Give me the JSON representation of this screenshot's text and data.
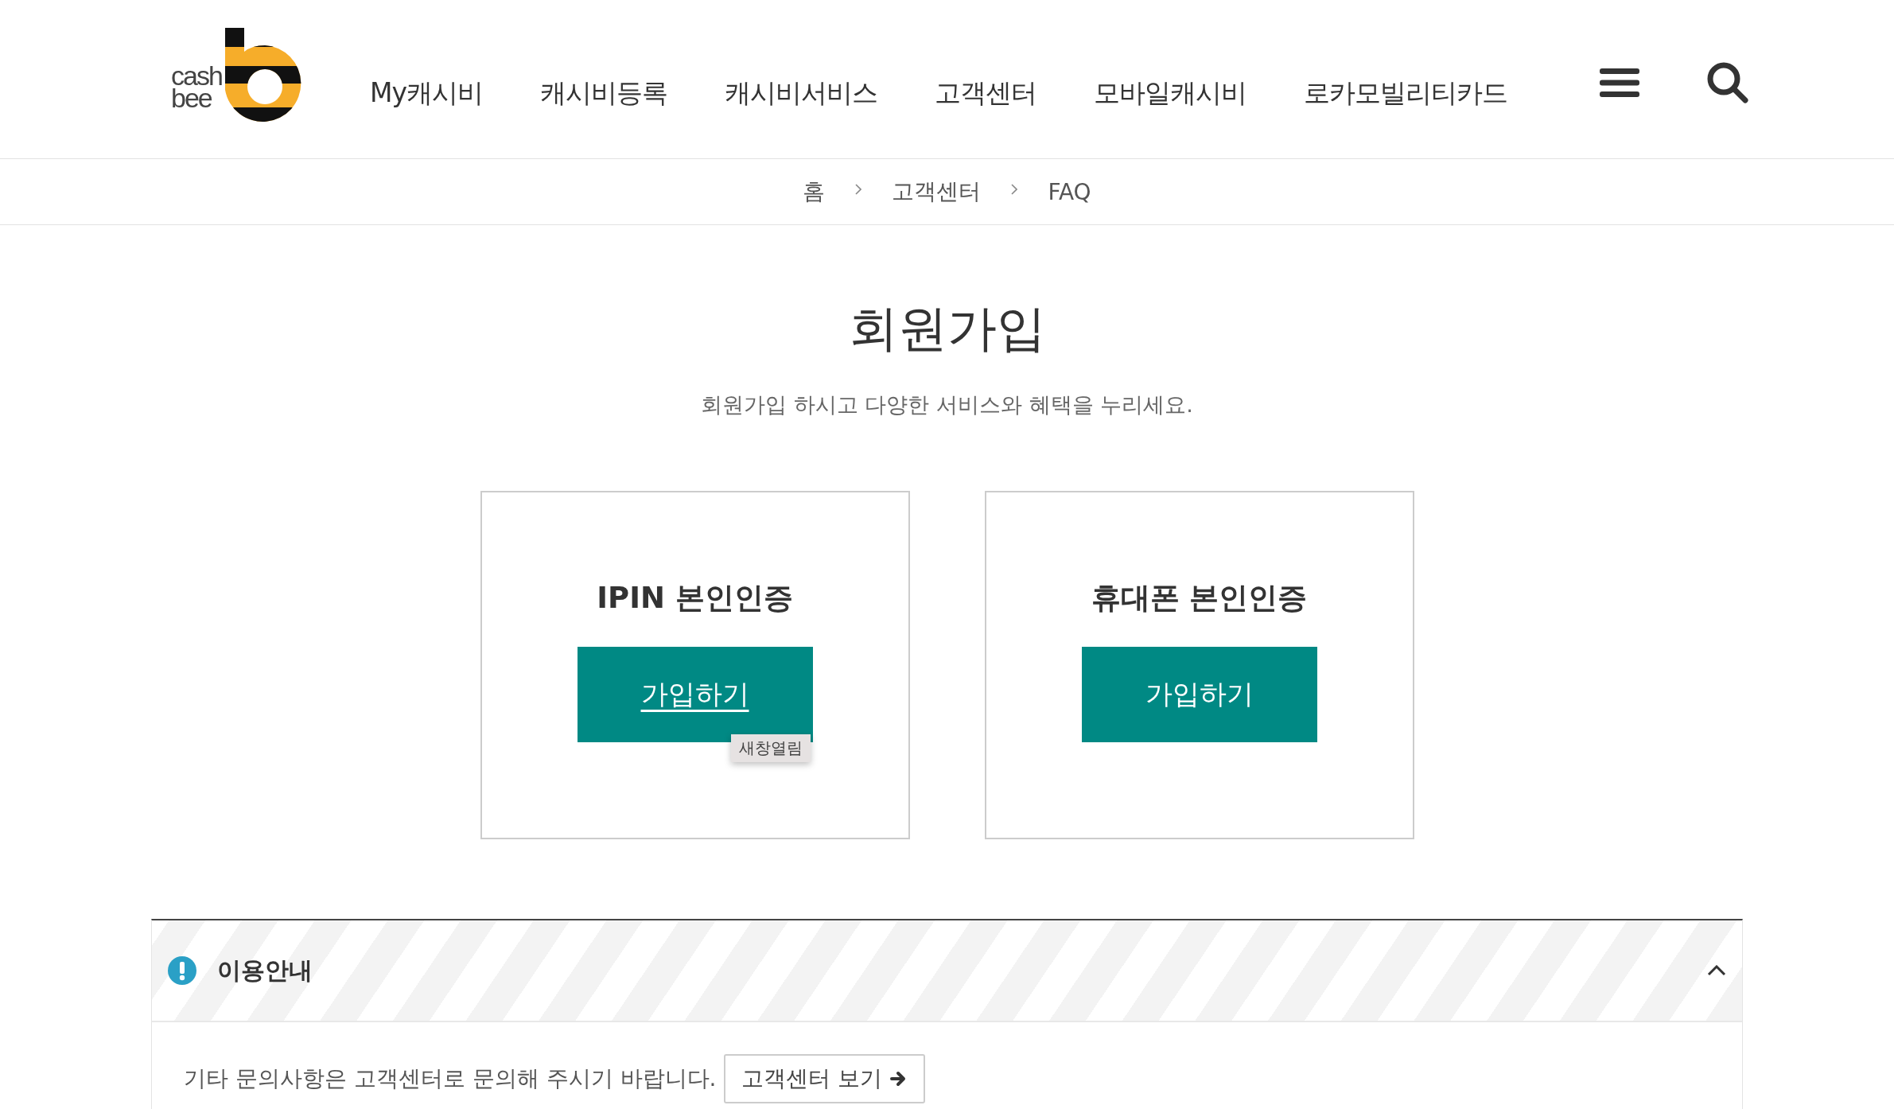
{
  "logo": {
    "line_1": "cash",
    "line_2": "bee"
  },
  "nav": [
    {
      "label": "My캐시비"
    },
    {
      "label": "캐시비등록"
    },
    {
      "label": "캐시비서비스"
    },
    {
      "label": "고객센터"
    },
    {
      "label": "모바일캐시비"
    },
    {
      "label": "로카모빌리티카드"
    }
  ],
  "breadcrumb": [
    "홈",
    "고객센터",
    "FAQ"
  ],
  "page_title": "회원가입",
  "subtitle": "회원가입 하시고 다양한 서비스와 혜택을 누리세요.",
  "cards": [
    {
      "title": "IPIN 본인인증",
      "button": "가입하기",
      "hovered": true,
      "tooltip": "새창열림"
    },
    {
      "title": "휴대폰 본인인증",
      "button": "가입하기",
      "hovered": false
    }
  ],
  "notice": {
    "title": "이용안내",
    "expanded": true,
    "text": "기타 문의사항은 고객센터로 문의해 주시기 바랍니다.",
    "link": "고객센터 보기"
  }
}
